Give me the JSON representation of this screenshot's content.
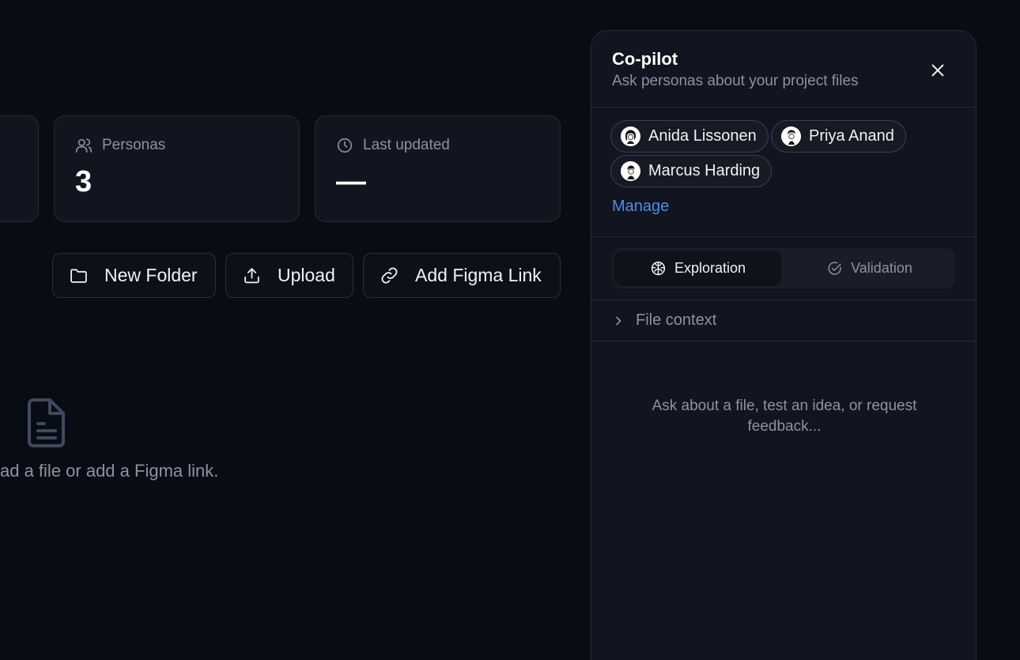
{
  "stats": {
    "personas": {
      "label": "Personas",
      "value": "3",
      "icon": "users-icon"
    },
    "last_updated": {
      "label": "Last updated",
      "value": "—",
      "icon": "clock-icon"
    }
  },
  "actions": {
    "new_folder": "New Folder",
    "upload": "Upload",
    "add_figma_link": "Add Figma Link"
  },
  "empty_state": {
    "text": "ad a file or add a Figma link.",
    "icon": "file-text-icon"
  },
  "copilot": {
    "title": "Co-pilot",
    "subtitle": "Ask personas about your project files",
    "personas": [
      {
        "name": "Anida Lissonen"
      },
      {
        "name": "Priya Anand"
      },
      {
        "name": "Marcus Harding"
      }
    ],
    "manage_label": "Manage",
    "modes": [
      {
        "label": "Exploration",
        "active": true,
        "icon": "brain-icon"
      },
      {
        "label": "Validation",
        "active": false,
        "icon": "check-circle-icon"
      }
    ],
    "file_context_label": "File context",
    "empty_prompt": "Ask about a file, test an idea, or request feedback..."
  },
  "colors": {
    "background": "#0a0c14",
    "card": "#12151f",
    "border": "#252a36",
    "accent_link": "#4a8ee8",
    "muted_text": "#8b92a3"
  }
}
